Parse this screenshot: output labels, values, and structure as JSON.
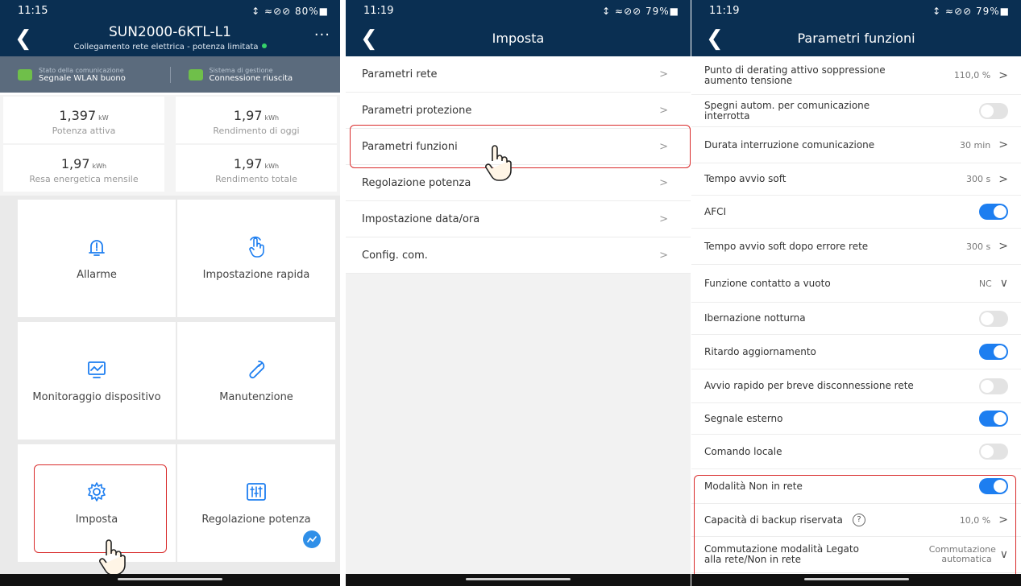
{
  "panel1": {
    "status_time": "11:15",
    "status_right": "↕ ≈⊘⊘ 80%■",
    "title": "SUN2000-6KTL-L1",
    "subtitle": "Collegamento rete elettrica - potenza limitata",
    "more": "···",
    "comm": [
      {
        "label": "Stato della comunicazione",
        "value": "Segnale WLAN buono"
      },
      {
        "label": "Sistema di gestione",
        "value": "Connessione riuscita"
      }
    ],
    "stats": [
      {
        "value": "1,397",
        "unit": "kW",
        "label": "Potenza attiva"
      },
      {
        "value": "1,97",
        "unit": "kWh",
        "label": "Rendimento di oggi"
      },
      {
        "value": "1,97",
        "unit": "kWh",
        "label": "Resa energetica mensile"
      },
      {
        "value": "1,97",
        "unit": "kWh",
        "label": "Rendimento totale"
      }
    ],
    "tiles": [
      {
        "label": "Allarme",
        "icon": "bell-icon"
      },
      {
        "label": "Impostazione rapida",
        "icon": "tap-hand-icon"
      },
      {
        "label": "Monitoraggio dispositivo",
        "icon": "monitor-icon"
      },
      {
        "label": "Manutenzione",
        "icon": "wrench-icon"
      },
      {
        "label": "Imposta",
        "icon": "gear-icon"
      },
      {
        "label": "Regolazione potenza",
        "icon": "sliders-icon"
      }
    ]
  },
  "panel2": {
    "status_time": "11:19",
    "status_right": "↕ ≈⊘⊘ 79%■",
    "title": "Imposta",
    "items": [
      {
        "label": "Parametri rete"
      },
      {
        "label": "Parametri protezione"
      },
      {
        "label": "Parametri funzioni"
      },
      {
        "label": "Regolazione potenza"
      },
      {
        "label": "Impostazione data/ora"
      },
      {
        "label": "Config. com."
      }
    ],
    "chevron": ">"
  },
  "panel3": {
    "status_time": "11:19",
    "status_right": "↕ ≈⊘⊘ 79%■",
    "title": "Parametri funzioni",
    "rows": [
      {
        "label": "Punto di derating attivo soppressione aumento tensione",
        "value": "110,0 %",
        "kind": "link"
      },
      {
        "label": "Spegni autom. per comunicazione interrotta",
        "value": "",
        "kind": "toggle",
        "on": false
      },
      {
        "label": "Durata interruzione comunicazione",
        "value": "30 min",
        "kind": "link"
      },
      {
        "label": "Tempo avvio soft",
        "value": "300 s",
        "kind": "link"
      },
      {
        "label": "AFCI",
        "value": "",
        "kind": "toggle",
        "on": true
      },
      {
        "label": "Tempo avvio soft dopo errore rete",
        "value": "300 s",
        "kind": "link"
      },
      {
        "label": "Funzione contatto a vuoto",
        "value": "NC",
        "kind": "dropdown"
      },
      {
        "label": "Ibernazione notturna",
        "value": "",
        "kind": "toggle",
        "on": false
      },
      {
        "label": "Ritardo aggiornamento",
        "value": "",
        "kind": "toggle",
        "on": true
      },
      {
        "label": "Avvio rapido per breve disconnessione rete",
        "value": "",
        "kind": "toggle",
        "on": false
      },
      {
        "label": "Segnale esterno",
        "value": "",
        "kind": "toggle",
        "on": true
      },
      {
        "label": "Comando locale",
        "value": "",
        "kind": "toggle",
        "on": false
      },
      {
        "label": "Modalità Non in rete",
        "value": "",
        "kind": "toggle",
        "on": true
      },
      {
        "label": "Capacità di backup riservata",
        "value": "10,0 %",
        "kind": "link",
        "help": "?"
      },
      {
        "label": "Commutazione modalità Legato alla rete/Non in rete",
        "value": "Commutazione automatica",
        "kind": "dropdown"
      }
    ]
  },
  "colors": {
    "header": "#0a2f52",
    "accent": "#1d7ef0",
    "highlight": "#d92b2b"
  }
}
